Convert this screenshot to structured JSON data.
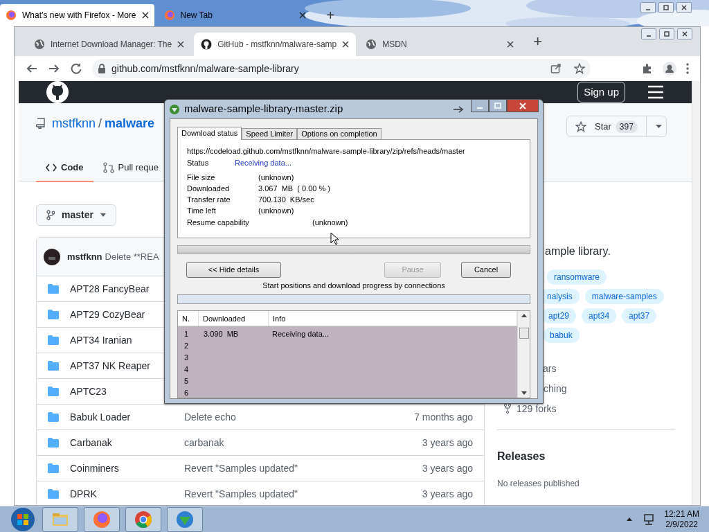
{
  "firefox": {
    "tabs": [
      {
        "title": "What’s new with Firefox - More",
        "selected": true
      },
      {
        "title": "New Tab",
        "selected": false
      }
    ],
    "new_tab": "+"
  },
  "chrome": {
    "tabs": [
      {
        "title": "Internet Download Manager: The",
        "selected": false
      },
      {
        "title": "GitHub - mstfknn/malware-samp",
        "selected": true
      },
      {
        "title": "MSDN",
        "selected": false
      }
    ],
    "new_tab": "+",
    "url": "github.com/mstfknn/malware-sample-library"
  },
  "github": {
    "sign_up": "Sign up",
    "owner": "mstfknn",
    "separator": "/",
    "repo": "malware",
    "star": "Star",
    "star_count": "397",
    "tabs": [
      {
        "label": "Code",
        "selected": true
      },
      {
        "label": "Pull reque",
        "selected": false
      }
    ],
    "branch": "master",
    "commit": {
      "author": "mstfknn",
      "message": "Delete **REA"
    },
    "files": [
      {
        "name": "APT28 FancyBear"
      },
      {
        "name": "APT29 CozyBear"
      },
      {
        "name": "APT34 Iranian"
      },
      {
        "name": "APT37 NK Reaper"
      },
      {
        "name": "APTC23"
      },
      {
        "name": "Babuk Loader",
        "message": "Delete echo",
        "time": "7 months ago"
      },
      {
        "name": "Carbanak",
        "message": "carbanak",
        "time": "3 years ago"
      },
      {
        "name": "Coinminers",
        "message": "Revert \"Samples updated\"",
        "time": "3 years ago"
      },
      {
        "name": "DPRK",
        "message": "Revert \"Samples updated\"",
        "time": "3 years ago"
      }
    ],
    "about": "ample library.",
    "topic_rows": [
      [
        "ransomware"
      ],
      [
        "nalysis",
        "malware-samples"
      ],
      [
        "apt29",
        "apt34",
        "apt37"
      ],
      [
        "babuk"
      ]
    ],
    "stats": [
      "ars",
      "ching",
      "129 forks"
    ],
    "releases": {
      "title": "Releases",
      "empty": "No releases published"
    }
  },
  "dialog": {
    "title": "malware-sample-library-master.zip",
    "tabs": [
      {
        "label": "Download status",
        "selected": true
      },
      {
        "label": "Speed Limiter",
        "selected": false
      },
      {
        "label": "Options on completion",
        "selected": false
      }
    ],
    "url": "https://codeload.github.com/mstfknn/malware-sample-library/zip/refs/heads/master",
    "status": {
      "label": "Status",
      "value": "Receiving data..."
    },
    "details": [
      {
        "label": "File size",
        "value": "(unknown)"
      },
      {
        "label": "Downloaded",
        "value": "3.067  MB  ( 0.00 % )"
      },
      {
        "label": "Transfer rate",
        "value": "700.130  KB/sec"
      },
      {
        "label": "Time left",
        "value": "(unknown)"
      }
    ],
    "resume": {
      "label": "Resume capability",
      "value": "(unknown)"
    },
    "progress": {
      "level": 0
    },
    "buttons": [
      {
        "label": "<< Hide details",
        "disabled": false
      },
      {
        "label": "Pause",
        "disabled": true
      },
      {
        "label": "Cancel",
        "disabled": false
      }
    ],
    "connections_label": "Start positions and download progress by connections",
    "columns": [
      "N.",
      "Downloaded",
      "Info"
    ],
    "rows": [
      {
        "n": "1",
        "downloaded": "3.090  MB",
        "info": "Receiving data..."
      },
      {
        "n": "2"
      },
      {
        "n": "3"
      },
      {
        "n": "4"
      },
      {
        "n": "5"
      },
      {
        "n": "6"
      }
    ]
  },
  "taskbar": {
    "time": "12:21 AM",
    "date": "2/9/2022"
  }
}
